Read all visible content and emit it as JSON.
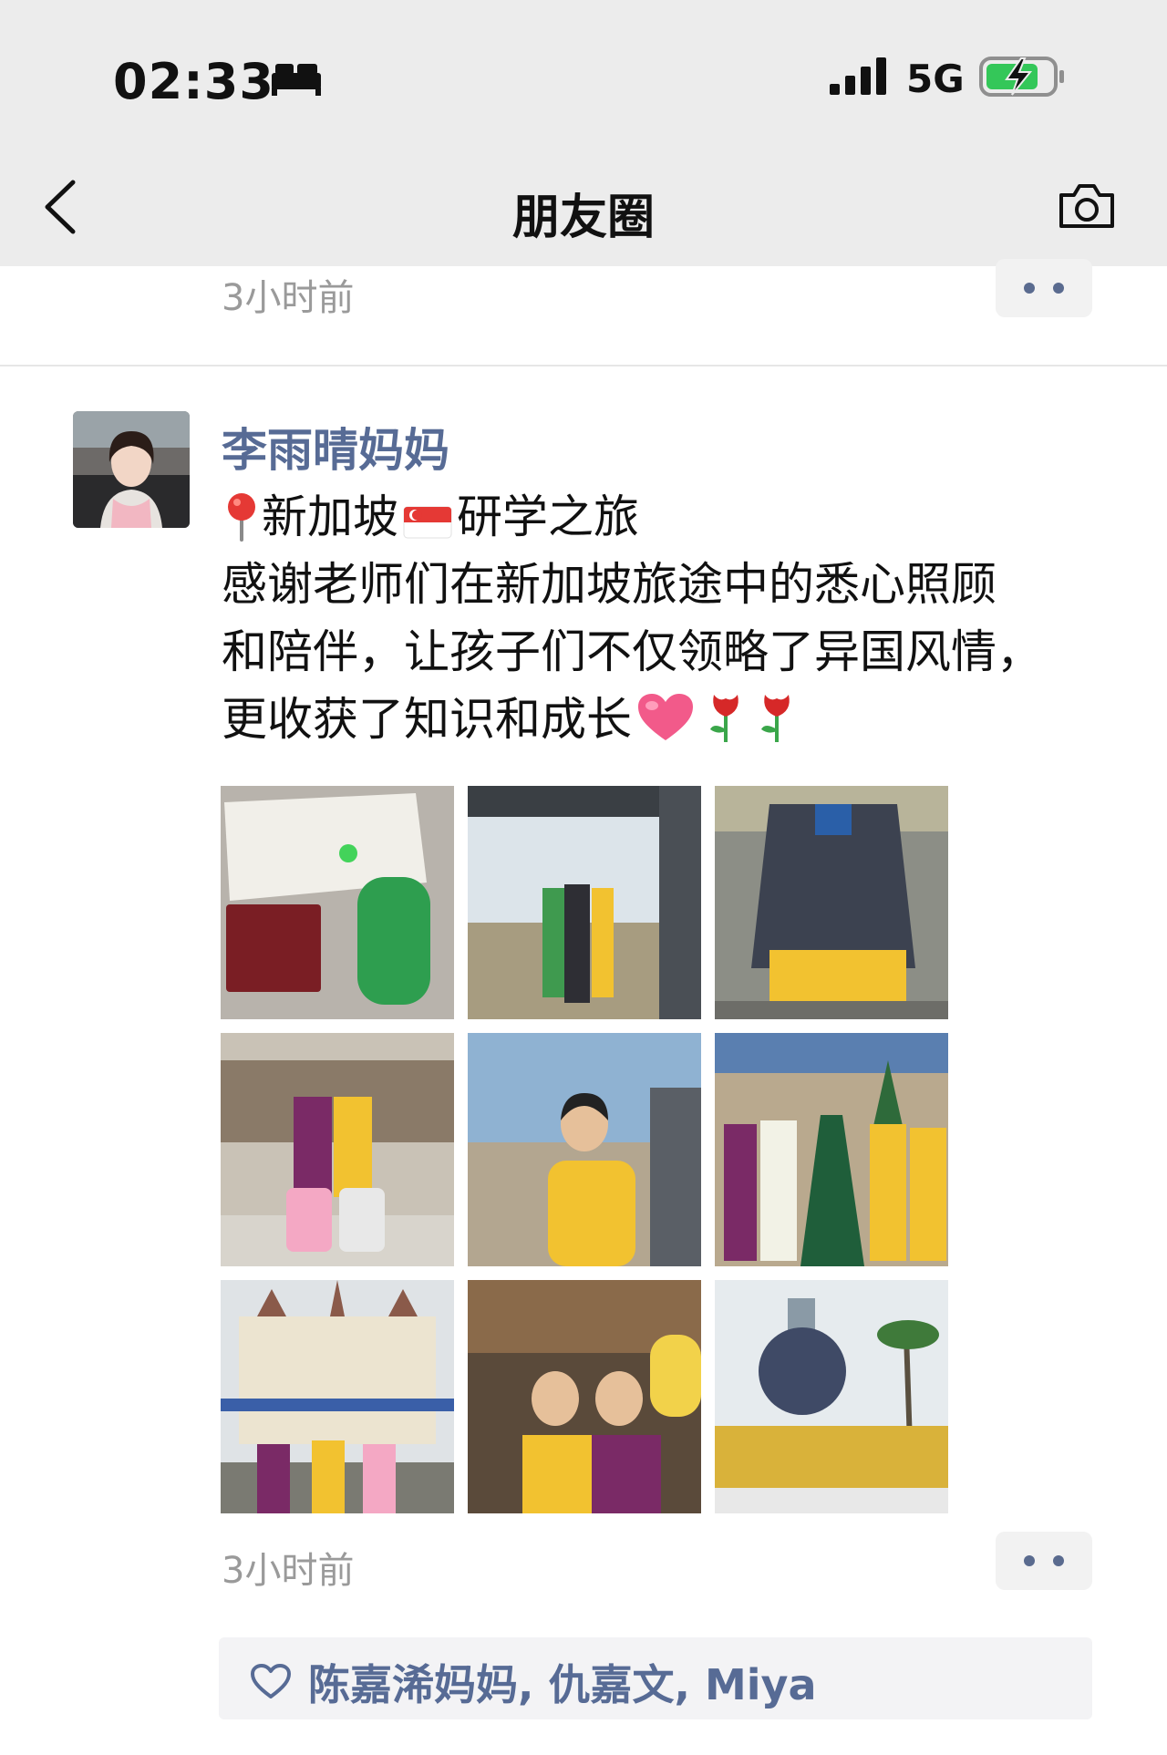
{
  "status_bar": {
    "time": "02:33",
    "network": "5G",
    "icons": [
      "bed-icon",
      "signal-icon",
      "battery-charging-icon"
    ]
  },
  "nav": {
    "title": "朋友圈",
    "back_icon": "chevron-left-icon",
    "camera_icon": "camera-icon"
  },
  "previous_post": {
    "time": "3小时前"
  },
  "post": {
    "author": "李雨晴妈妈",
    "lines": [
      {
        "prefix_icon": "pin-icon",
        "part1": "新加坡",
        "flag_icon": "singapore-flag-icon",
        "part2": "研学之旅"
      },
      {
        "text": "感谢老师们在新加坡旅途中的悉心照顾"
      },
      {
        "text": "和陪伴，让孩子们不仅领略了异国风情，"
      },
      {
        "text": "更收获了知识和成长",
        "suffix_icons": [
          "heart-emoji-icon",
          "rose-icon",
          "rose-icon"
        ]
      }
    ],
    "photos": [
      {
        "name": "boarding-pass-passport-photo"
      },
      {
        "name": "airport-window-group-photo"
      },
      {
        "name": "transformer-statue-photo"
      },
      {
        "name": "checkin-counter-luggage-photo"
      },
      {
        "name": "airport-window-child-photo"
      },
      {
        "name": "princess-group-photo"
      },
      {
        "name": "castle-photo"
      },
      {
        "name": "parade-children-photo"
      },
      {
        "name": "universal-globe-group-photo"
      }
    ],
    "time": "3小时前",
    "likes": "陈嘉浠妈妈, 仇嘉文, Miya"
  },
  "colors": {
    "link": "#576b95",
    "meta": "#9a9a9a",
    "header_bg": "#ececec",
    "likes_bg": "#f3f3f5"
  }
}
